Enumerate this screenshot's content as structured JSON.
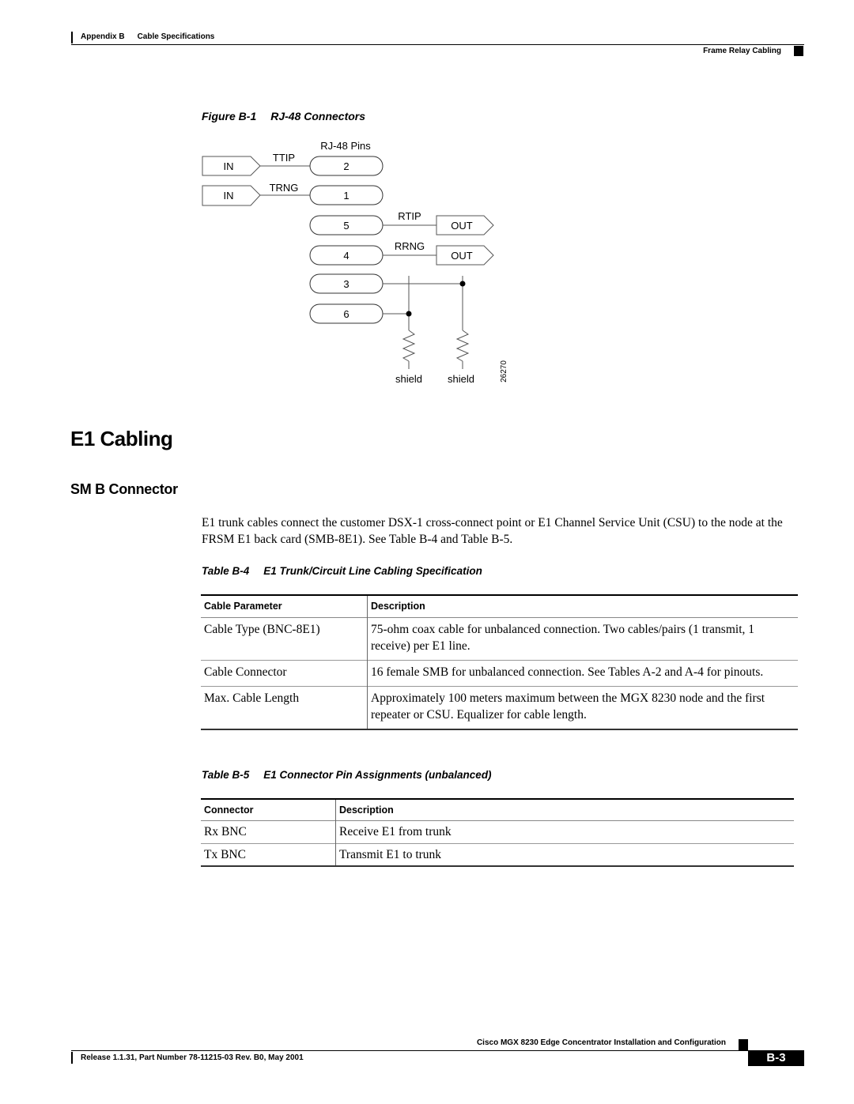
{
  "header": {
    "appendix": "Appendix B",
    "chapter": "Cable Specifications",
    "section": "Frame Relay Cabling"
  },
  "figure": {
    "number": "Figure B-1",
    "title": "RJ-48 Connectors",
    "pins_label": "RJ-48 Pins",
    "inputs": [
      {
        "label": "IN",
        "signal": "TTIP",
        "pin": "2"
      },
      {
        "label": "IN",
        "signal": "TRNG",
        "pin": "1"
      }
    ],
    "outputs": [
      {
        "pin": "5",
        "signal": "RTIP",
        "label": "OUT"
      },
      {
        "pin": "4",
        "signal": "RRNG",
        "label": "OUT"
      }
    ],
    "shield_pins": [
      "3",
      "6"
    ],
    "shield_labels": [
      "shield",
      "shield"
    ],
    "art_id": "26270"
  },
  "section": {
    "title": "E1 Cabling",
    "subsection": "SM B Connector",
    "paragraph": "E1 trunk cables connect the customer DSX-1 cross-connect point or E1 Channel Service Unit (CSU) to the node at the FRSM E1 back card (SMB-8E1). See Table B-4 and Table B-5."
  },
  "table_b4": {
    "number": "Table B-4",
    "title": "E1 Trunk/Circuit Line Cabling Specification",
    "headers": [
      "Cable Parameter",
      "Description"
    ],
    "rows": [
      {
        "param": "Cable Type (BNC-8E1)",
        "desc": "75-ohm coax cable for unbalanced connection. Two cables/pairs (1 transmit, 1 receive) per E1 line."
      },
      {
        "param": "Cable Connector",
        "desc": "16 female SMB for unbalanced connection. See Tables A-2 and A-4 for pinouts."
      },
      {
        "param": "Max. Cable Length",
        "desc": "Approximately 100 meters maximum between the MGX 8230 node and the first repeater or CSU. Equalizer for cable length."
      }
    ]
  },
  "table_b5": {
    "number": "Table B-5",
    "title": "E1 Connector Pin Assignments (unbalanced)",
    "headers": [
      "Connector",
      "Description"
    ],
    "rows": [
      {
        "connector": "Rx BNC",
        "desc": "Receive E1 from trunk"
      },
      {
        "connector": "Tx BNC",
        "desc": "Transmit E1 to trunk"
      }
    ]
  },
  "footer": {
    "book_title": "Cisco MGX 8230 Edge Concentrator Installation and Configuration",
    "release": "Release 1.1.31, Part Number 78-11215-03 Rev. B0, May 2001",
    "page": "B-3"
  }
}
